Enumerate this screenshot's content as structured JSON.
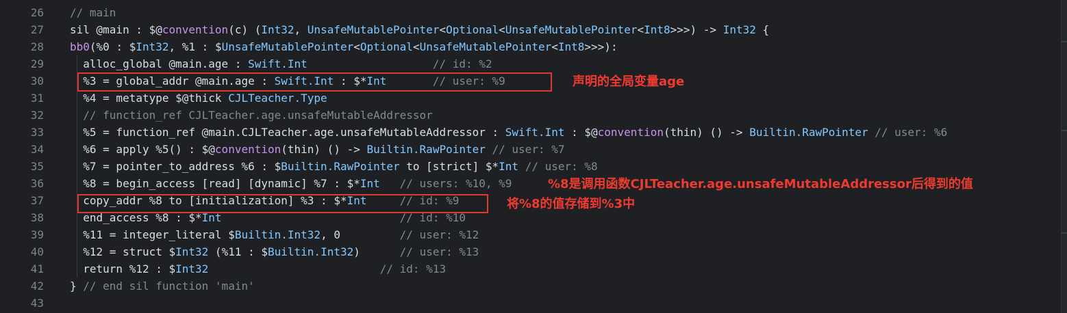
{
  "editor": {
    "lines": [
      {
        "num": "26",
        "parts": [
          [
            "cmt",
            "// main"
          ]
        ]
      },
      {
        "num": "27",
        "parts": [
          [
            "txt",
            "sil @main : $@"
          ],
          [
            "kw",
            "convention"
          ],
          [
            "txt",
            "(c) ("
          ],
          [
            "ty",
            "Int32"
          ],
          [
            "txt",
            ", "
          ],
          [
            "ty",
            "UnsafeMutablePointer"
          ],
          [
            "txt",
            "<"
          ],
          [
            "ty",
            "Optional"
          ],
          [
            "txt",
            "<"
          ],
          [
            "ty",
            "UnsafeMutablePointer"
          ],
          [
            "txt",
            "<"
          ],
          [
            "ty",
            "Int8"
          ],
          [
            "txt",
            ">>>) -> "
          ],
          [
            "ty",
            "Int32"
          ],
          [
            "txt",
            " {"
          ]
        ]
      },
      {
        "num": "28",
        "parts": [
          [
            "kw",
            "bb0"
          ],
          [
            "txt",
            "(%0 : $"
          ],
          [
            "ty",
            "Int32"
          ],
          [
            "txt",
            ", %1 : $"
          ],
          [
            "ty",
            "UnsafeMutablePointer"
          ],
          [
            "txt",
            "<"
          ],
          [
            "ty",
            "Optional"
          ],
          [
            "txt",
            "<"
          ],
          [
            "ty",
            "UnsafeMutablePointer"
          ],
          [
            "txt",
            "<"
          ],
          [
            "ty",
            "Int8"
          ],
          [
            "txt",
            ">>>):"
          ]
        ]
      },
      {
        "num": "29",
        "parts": [
          [
            "txt",
            "  alloc_global @main.age : "
          ],
          [
            "ty",
            "Swift.Int"
          ],
          [
            "txt",
            "                   "
          ],
          [
            "cmt",
            "// id: %2"
          ]
        ]
      },
      {
        "num": "30",
        "parts": [
          [
            "txt",
            "  %3 = global_addr @main.age : "
          ],
          [
            "ty",
            "Swift.Int"
          ],
          [
            "txt",
            " : $*"
          ],
          [
            "ty",
            "Int"
          ],
          [
            "txt",
            "       "
          ],
          [
            "cmt",
            "// user: %9"
          ]
        ]
      },
      {
        "num": "31",
        "parts": [
          [
            "txt",
            "  %4 = metatype $@thick "
          ],
          [
            "ty",
            "CJLTeacher.Type"
          ]
        ]
      },
      {
        "num": "32",
        "parts": [
          [
            "cmt",
            "  // function_ref CJLTeacher.age.unsafeMutableAddressor"
          ]
        ]
      },
      {
        "num": "33",
        "parts": [
          [
            "txt",
            "  %5 = function_ref @main.CJLTeacher.age.unsafeMutableAddressor : "
          ],
          [
            "ty",
            "Swift.Int"
          ],
          [
            "txt",
            " : $@"
          ],
          [
            "kw",
            "convention"
          ],
          [
            "txt",
            "(thin) () -> "
          ],
          [
            "ty",
            "Builtin.RawPointer"
          ],
          [
            "txt",
            " "
          ],
          [
            "cmt",
            "// user: %6"
          ]
        ]
      },
      {
        "num": "34",
        "parts": [
          [
            "txt",
            "  %6 = apply %5() : $@"
          ],
          [
            "kw",
            "convention"
          ],
          [
            "txt",
            "(thin) () -> "
          ],
          [
            "ty",
            "Builtin.RawPointer"
          ],
          [
            "txt",
            " "
          ],
          [
            "cmt",
            "// user: %7"
          ]
        ]
      },
      {
        "num": "35",
        "parts": [
          [
            "txt",
            "  %7 = pointer_to_address %6 : $"
          ],
          [
            "ty",
            "Builtin.RawPointer"
          ],
          [
            "txt",
            " to [strict] $*"
          ],
          [
            "ty",
            "Int"
          ],
          [
            "txt",
            " "
          ],
          [
            "cmt",
            "// user: %8"
          ]
        ]
      },
      {
        "num": "36",
        "parts": [
          [
            "txt",
            "  %8 = begin_access [read] [dynamic] %7 : $*"
          ],
          [
            "ty",
            "Int"
          ],
          [
            "txt",
            "   "
          ],
          [
            "cmt",
            "// users: %10, %9"
          ]
        ]
      },
      {
        "num": "37",
        "parts": [
          [
            "txt",
            "  copy_addr %8 to [initialization] %3 : $*"
          ],
          [
            "ty",
            "Int"
          ],
          [
            "txt",
            "     "
          ],
          [
            "cmt",
            "// id: %9"
          ]
        ]
      },
      {
        "num": "38",
        "parts": [
          [
            "txt",
            "  end_access %8 : $*"
          ],
          [
            "ty",
            "Int"
          ],
          [
            "txt",
            "                           "
          ],
          [
            "cmt",
            "// id: %10"
          ]
        ]
      },
      {
        "num": "39",
        "parts": [
          [
            "txt",
            "  %11 = integer_literal $"
          ],
          [
            "ty",
            "Builtin.Int32"
          ],
          [
            "txt",
            ", 0         "
          ],
          [
            "cmt",
            "// user: %12"
          ]
        ]
      },
      {
        "num": "40",
        "parts": [
          [
            "txt",
            "  %12 = struct $"
          ],
          [
            "ty",
            "Int32"
          ],
          [
            "txt",
            " (%11 : $"
          ],
          [
            "ty",
            "Builtin.Int32"
          ],
          [
            "txt",
            ")      "
          ],
          [
            "cmt",
            "// user: %13"
          ]
        ]
      },
      {
        "num": "41",
        "parts": [
          [
            "txt",
            "  return %12 : $"
          ],
          [
            "ty",
            "Int32"
          ],
          [
            "txt",
            "                          "
          ],
          [
            "cmt",
            "// id: %13"
          ]
        ]
      },
      {
        "num": "42",
        "parts": [
          [
            "txt",
            "} "
          ],
          [
            "cmt",
            "// end sil function 'main'"
          ]
        ]
      },
      {
        "num": "43",
        "parts": []
      }
    ]
  },
  "annotations": {
    "note_global": "声明的全局变量age",
    "note_access": "%8是调用函数CJLTeacher.age.unsafeMutableAddressor后得到的值",
    "note_copy": "将%8的值存储到%3中"
  }
}
